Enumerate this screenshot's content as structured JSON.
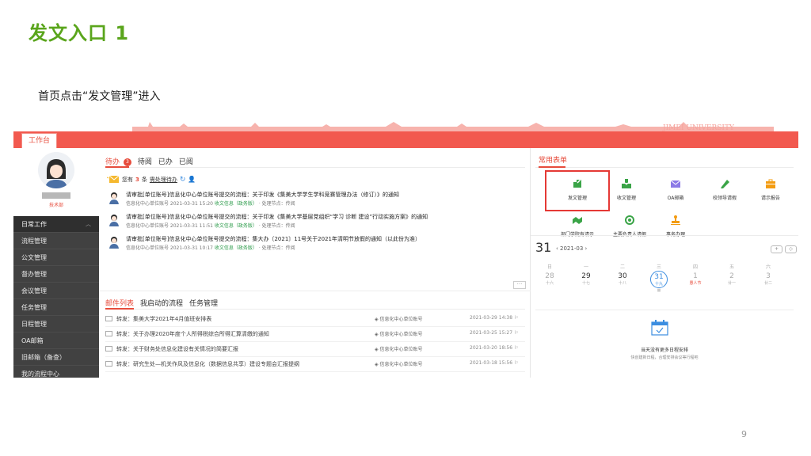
{
  "slide": {
    "title": "发文入口 1",
    "description": "首页点击“发文管理”进入",
    "page_number": "9"
  },
  "app": {
    "workbench_tab": "工作台",
    "colors": {
      "accent": "#f2594f",
      "sidebar": "#414141",
      "highlight": "#e53935",
      "title_green": "#5aa51c"
    }
  },
  "sidebar": {
    "user_role": "技术部",
    "items": [
      {
        "label": "日常工作",
        "head": true
      },
      {
        "label": "流程管理"
      },
      {
        "label": "公文管理"
      },
      {
        "label": "督办管理"
      },
      {
        "label": "会议管理"
      },
      {
        "label": "任务管理"
      },
      {
        "label": "日程管理"
      },
      {
        "label": "OA邮箱"
      },
      {
        "label": "旧邮箱（备查）"
      },
      {
        "label": "我的流程中心"
      }
    ]
  },
  "main": {
    "tabs": [
      "待办",
      "待阅",
      "已办",
      "已阅"
    ],
    "todo_badge": "3",
    "notice": {
      "prefix": "您有",
      "count": "3",
      "unit": "条",
      "link": "需处理待办"
    },
    "todos": [
      {
        "title": "请审批[单位账号]信息化中心单位账号提交的流程：关于印发《集美大学学生学科竞赛管理办法（修订）》的通知",
        "meta_prefix": "信息化中心单位账号   2021-03-31 15:20",
        "source": "收文信息（政务版）",
        "meta_suffix": "· 处理节点：传阅"
      },
      {
        "title": "请审批[单位账号]信息化中心单位账号提交的流程：关于印发《集美大学基层党组织“学习 诊断 建设”行动实施方案》的通知",
        "meta_prefix": "信息化中心单位账号   2021-03-31 11:51",
        "source": "收文信息（政务版）",
        "meta_suffix": "· 处理节点：传阅"
      },
      {
        "title": "请审批[单位账号]信息化中心单位账号提交的流程：集大办〔2021〕11号关于2021年清明节放假的通知（以此份为准）",
        "meta_prefix": "信息化中心单位账号   2021-03-31 10:17",
        "source": "收文信息（政务版）",
        "meta_suffix": "· 处理节点：传阅"
      }
    ],
    "more": "···",
    "tabs2": [
      "邮件列表",
      "我启动的流程",
      "任务管理"
    ],
    "mails": [
      {
        "subject": "转发：集美大学2021年4月值班安排表",
        "sender": "信息化中心单位账号",
        "time": "2021-03-29 14:38"
      },
      {
        "subject": "转发：关于办理2020年度个人所得税综合所得汇算清缴的通知",
        "sender": "信息化中心单位账号",
        "time": "2021-03-25 15:27"
      },
      {
        "subject": "转发：关于财务处信息化建设有关情况的简要汇报",
        "sender": "信息化中心单位账号",
        "time": "2021-03-20 18:56"
      },
      {
        "subject": "转发：研究生处—机关作风及信息化（数据信息共享）建设专题会汇报提纲",
        "sender": "信息化中心单位账号",
        "time": "2021-03-18 15:56"
      }
    ]
  },
  "right": {
    "tab": "常用表单",
    "apps_row1": [
      {
        "label": "发文管理",
        "icon": "document-pen-icon",
        "color": "#3aa447"
      },
      {
        "label": "收文管理",
        "icon": "document-inbox-icon",
        "color": "#3aa447"
      },
      {
        "label": "OA邮箱",
        "icon": "envelope-icon",
        "color": "#8c7ae6"
      },
      {
        "label": "校领导请假",
        "icon": "pen-icon",
        "color": "#3aa447"
      },
      {
        "label": "请示报告",
        "icon": "briefcase-icon",
        "color": "#f39c12"
      }
    ],
    "apps_row2": [
      {
        "label": "部门学院有请示",
        "icon": "handshake-icon",
        "color": "#3aa447"
      },
      {
        "label": "主要负责人请假",
        "icon": "gear-icon",
        "color": "#3aa447"
      },
      {
        "label": "事务办理",
        "icon": "stamp-icon",
        "color": "#f39c12"
      }
    ],
    "calendar": {
      "day": "31",
      "month": "‹ 2021-03 ›",
      "weekdays": [
        {
          "name": "日",
          "date": "28",
          "lunar": "十六"
        },
        {
          "name": "一",
          "date": "29",
          "lunar": "十七"
        },
        {
          "name": "二",
          "date": "30",
          "lunar": "十八"
        },
        {
          "name": "三",
          "date": "31",
          "lunar": "十九"
        },
        {
          "name": "四",
          "date": "1",
          "lunar": "愚人节"
        },
        {
          "name": "五",
          "date": "2",
          "lunar": "廿一"
        },
        {
          "name": "六",
          "date": "3",
          "lunar": "廿二"
        }
      ],
      "today_extra": "■",
      "empty_title": "当天没有更多日程安排",
      "empty_sub": "快创建新日程，合理安排会议等行程吧"
    }
  }
}
